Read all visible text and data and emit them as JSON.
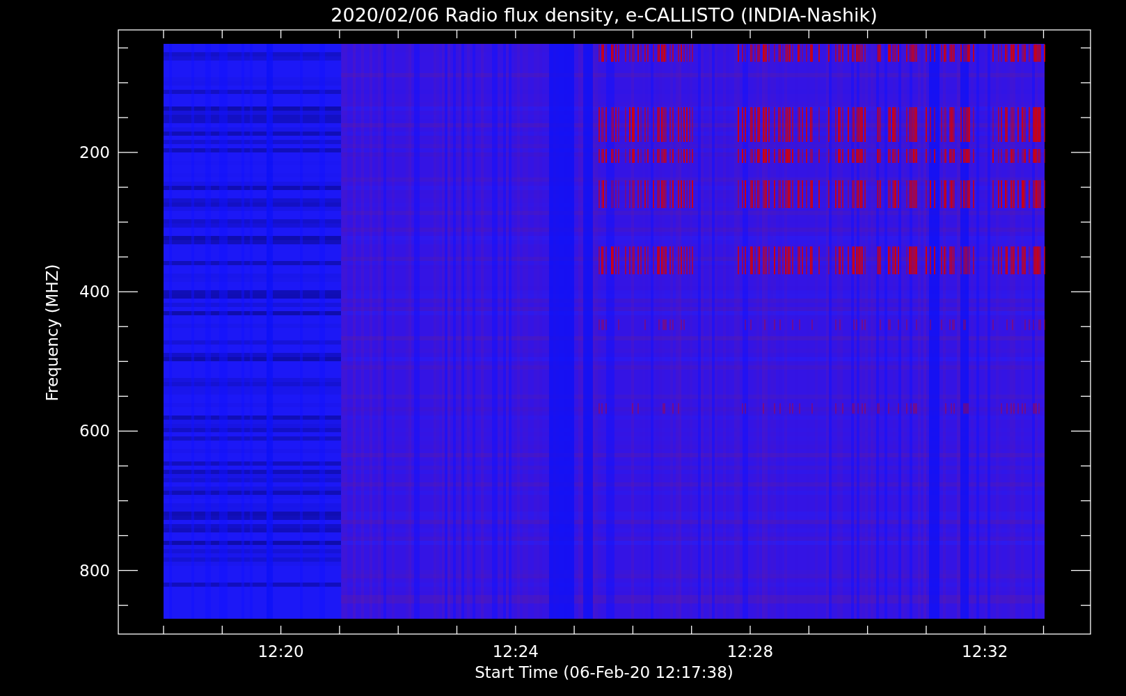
{
  "plot": {
    "title": "2020/02/06  Radio flux density, e-CALLISTO (INDIA-Nashik)",
    "xlabel": "Start Time (06-Feb-20 12:17:38)",
    "ylabel": "Frequency (MHZ)",
    "xticks": [
      "12:20",
      "12:24",
      "12:28",
      "12:32"
    ],
    "yticks": [
      "200",
      "400",
      "600",
      "800"
    ]
  }
}
